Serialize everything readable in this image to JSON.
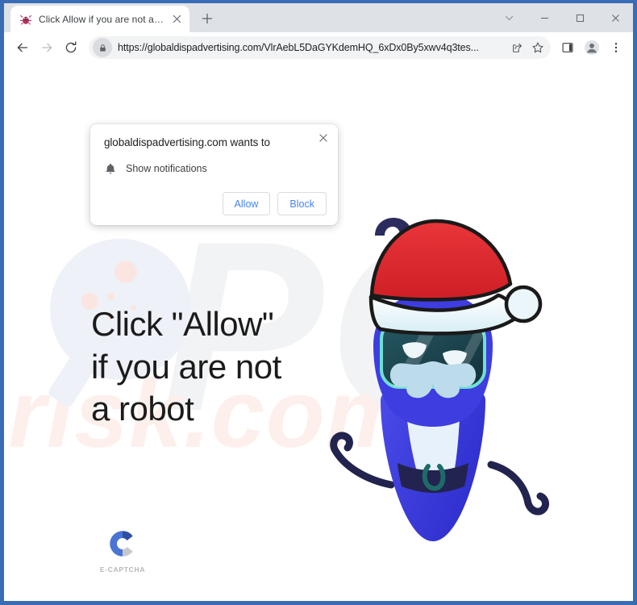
{
  "browser": {
    "tab": {
      "title": "Click Allow if you are not a robot",
      "favicon_icon": "bug-favicon",
      "close_icon": "close-icon"
    },
    "new_tab_icon": "plus-icon",
    "window_controls": [
      {
        "name": "tab-search",
        "icon": "chevron-down-icon"
      },
      {
        "name": "minimize",
        "icon": "minimize-icon"
      },
      {
        "name": "maximize",
        "icon": "maximize-icon"
      },
      {
        "name": "close",
        "icon": "close-icon"
      }
    ],
    "toolbar": {
      "back_icon": "back-arrow-icon",
      "forward_icon": "forward-arrow-icon",
      "reload_icon": "reload-icon",
      "lock_icon": "lock-icon",
      "url": "https://globaldispadvertising.com/VlrAebL5DaGYKdemHQ_6xDx0By5xwv4q3tes...",
      "share_icon": "share-icon",
      "bookmark_icon": "star-icon",
      "side_panel_icon": "side-panel-icon",
      "profile_icon": "profile-avatar-icon",
      "menu_icon": "three-dot-menu-icon"
    }
  },
  "permission_dialog": {
    "title": "globaldispadvertising.com wants to",
    "close_icon": "close-icon",
    "permission_icon": "bell-icon",
    "permission_label": "Show notifications",
    "allow_label": "Allow",
    "block_label": "Block"
  },
  "page": {
    "headline": "Click \"Allow\" if you are not a robot",
    "captcha_label": "E-CAPTCHA",
    "watermark_primary": "PC",
    "watermark_secondary": "risk.com",
    "character": "santa-hat-robot"
  },
  "colors": {
    "window_frame": "#3a6cb5",
    "tabstrip": "#dee1e6",
    "omnibox": "#f1f3f4",
    "link_blue": "#4285f4",
    "hat_red": "#e0262c",
    "robot_blue": "#3d3de0",
    "robot_dark": "#2b2b55",
    "visor_teal": "#1d4b54",
    "visor_border": "#6fe0cf",
    "watermark_gray": "#f2f3f5",
    "watermark_pink": "#fdf0ec",
    "bg_circle": "#eef1f7",
    "bg_dot_pink": "#fbe5e0"
  }
}
